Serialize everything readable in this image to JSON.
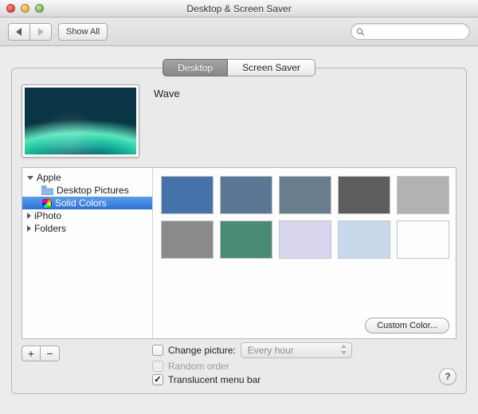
{
  "window": {
    "title": "Desktop & Screen Saver"
  },
  "toolbar": {
    "show_all": "Show All"
  },
  "search": {
    "placeholder": ""
  },
  "tabs": [
    {
      "label": "Desktop",
      "active": true
    },
    {
      "label": "Screen Saver",
      "active": false
    }
  ],
  "preview": {
    "name": "Wave"
  },
  "sidebar": {
    "items": [
      {
        "label": "Apple",
        "expanded": true,
        "children": [
          {
            "label": "Desktop Pictures",
            "selected": false,
            "icon": "folder"
          },
          {
            "label": "Solid Colors",
            "selected": true,
            "icon": "rainbow"
          }
        ]
      },
      {
        "label": "iPhoto",
        "expanded": false
      },
      {
        "label": "Folders",
        "expanded": false
      }
    ]
  },
  "swatches": [
    "#4472a9",
    "#5c7695",
    "#6a7d8d",
    "#5d5d5d",
    "#b2b2b2",
    "#8a8a8a",
    "#4a8b77",
    "#d8d6ee",
    "#cad9ea",
    "#fdfdfd"
  ],
  "custom_color_btn": "Custom Color...",
  "options": {
    "change_picture_label": "Change picture:",
    "change_picture_checked": false,
    "change_interval": "Every hour",
    "random_label": "Random order",
    "random_enabled": false,
    "translucent_label": "Translucent menu bar",
    "translucent_checked": true
  },
  "help_btn": "?"
}
